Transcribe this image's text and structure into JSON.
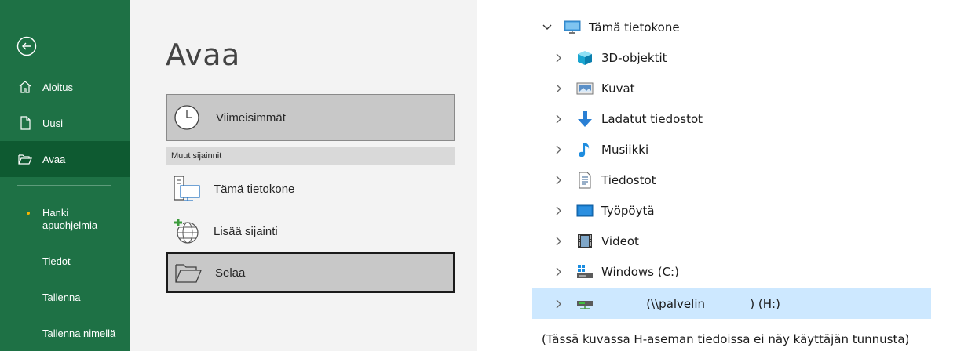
{
  "backstage": {
    "sidebar": {
      "home_label": "Aloitus",
      "new_label": "Uusi",
      "open_label": "Avaa",
      "addins_label_line1": "Hanki",
      "addins_label_line2": "apuohjelmia",
      "info_label": "Tiedot",
      "save_label": "Tallenna",
      "saveas_label": "Tallenna nimellä"
    },
    "open_panel": {
      "title": "Avaa",
      "recent_label": "Viimeisimmät",
      "other_locations_header": "Muut sijainnit",
      "locations": [
        {
          "label": "Tämä tietokone",
          "icon": "computer-icon"
        },
        {
          "label": "Lisää sijainti",
          "icon": "add-location-globe-icon"
        },
        {
          "label": "Selaa",
          "icon": "folder-open-icon"
        }
      ]
    },
    "colors": {
      "sidebar_bg": "#1e7145",
      "sidebar_selected": "#0e5a31",
      "panel_bg": "#f3f3f3"
    }
  },
  "explorer": {
    "root": {
      "label": "Tämä tietokone",
      "icon": "computer-icon",
      "expanded": true
    },
    "children": [
      {
        "label": "3D-objektit",
        "icon": "3d-objects-icon"
      },
      {
        "label": "Kuvat",
        "icon": "pictures-icon"
      },
      {
        "label": "Ladatut tiedostot",
        "icon": "downloads-icon"
      },
      {
        "label": "Musiikki",
        "icon": "music-icon"
      },
      {
        "label": "Tiedostot",
        "icon": "documents-icon"
      },
      {
        "label": "Työpöytä",
        "icon": "desktop-icon"
      },
      {
        "label": "Videot",
        "icon": "videos-icon"
      },
      {
        "label": "Windows (C:)",
        "icon": "drive-c-icon"
      },
      {
        "label": "            (\\\\palvelin            ) (H:)",
        "icon": "network-drive-icon",
        "selected": true
      }
    ],
    "caption": "(Tässä kuvassa H-aseman tiedoissa ei näy käyttäjän tunnusta)"
  }
}
